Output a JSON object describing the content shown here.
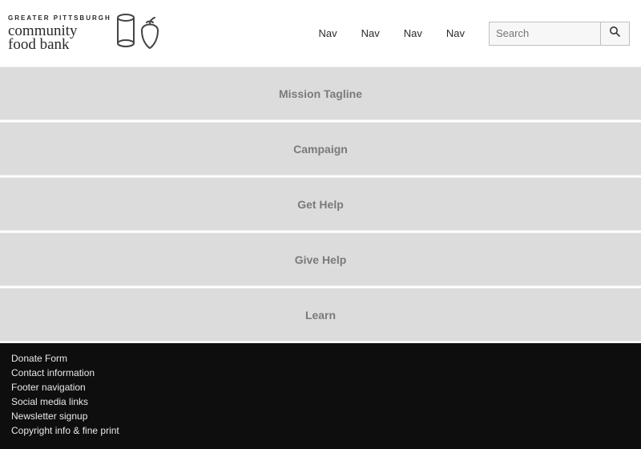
{
  "header": {
    "logo": {
      "line1": "GREATER PITTSBURGH",
      "line2": "community",
      "line3": "food bank"
    },
    "nav": [
      "Nav",
      "Nav",
      "Nav",
      "Nav"
    ],
    "search_placeholder": "Search"
  },
  "sections": [
    "Mission Tagline",
    "Campaign",
    "Get Help",
    "Give Help",
    "Learn"
  ],
  "footer": [
    "Donate Form",
    "Contact information",
    "Footer navigation",
    "Social media links",
    "Newsletter signup",
    "Copyright info & fine print"
  ]
}
